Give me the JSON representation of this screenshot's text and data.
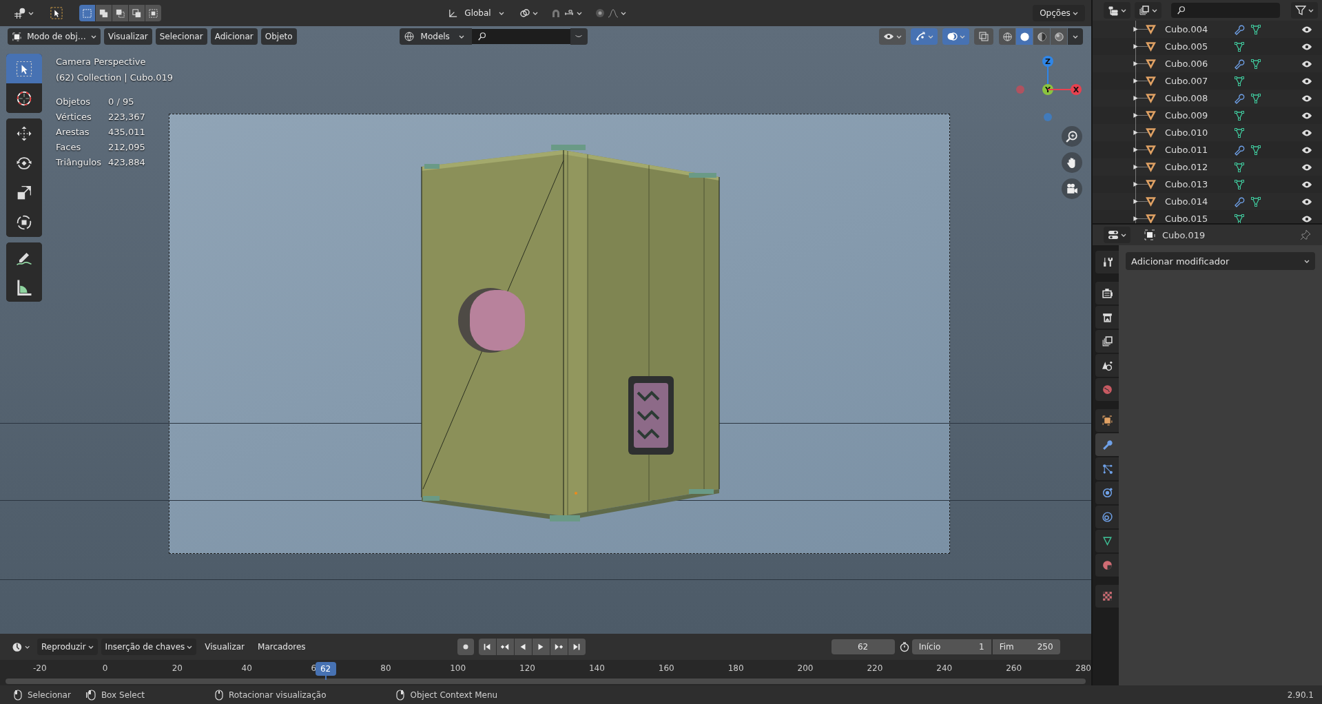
{
  "header": {
    "orientation": "Global",
    "snap_on": false,
    "proportional_on": false,
    "options": "Opções"
  },
  "select_modes": [
    {
      "selected": true
    },
    {
      "selected": false
    },
    {
      "selected": false
    },
    {
      "selected": false
    },
    {
      "selected": false
    }
  ],
  "viewport_header": {
    "mode": "Modo de obj…",
    "menus": [
      "Visualizar",
      "Selecionar",
      "Adicionar",
      "Objeto"
    ],
    "collection": "Models"
  },
  "viewport_toggles": [
    {
      "kind": "visibility",
      "on": false
    },
    {
      "kind": "gizmo",
      "on": true
    },
    {
      "kind": "overlays",
      "on": true
    },
    {
      "kind": "xray",
      "on": false
    }
  ],
  "shading": [
    {
      "kind": "wireframe",
      "selected": false
    },
    {
      "kind": "solid",
      "selected": true
    },
    {
      "kind": "material",
      "selected": false
    },
    {
      "kind": "rendered",
      "selected": false
    }
  ],
  "tools": [
    {
      "kind": "select_box",
      "selected": true
    },
    {
      "kind": "cursor",
      "selected": false
    },
    {
      "kind": "move",
      "selected": false
    },
    {
      "kind": "rotate",
      "selected": false
    },
    {
      "kind": "scale",
      "selected": false
    },
    {
      "kind": "transform",
      "selected": false
    },
    {
      "kind": "annotate",
      "selected": false
    },
    {
      "kind": "measure",
      "selected": false
    }
  ],
  "overlay": {
    "view": "Camera Perspective",
    "context": "(62) Collection | Cubo.019"
  },
  "stats": [
    {
      "label": "Objetos",
      "value": "0 / 95"
    },
    {
      "label": "Vértices",
      "value": "223,367"
    },
    {
      "label": "Arestas",
      "value": "435,011"
    },
    {
      "label": "Faces",
      "value": "212,095"
    },
    {
      "label": "Triângulos",
      "value": "423,884"
    }
  ],
  "gizmo": [
    {
      "label": "Z",
      "color": "#2f86e8"
    },
    {
      "label": "Y",
      "color": "#8bc43f"
    },
    {
      "label": "X",
      "color": "#e8414f"
    }
  ],
  "outliner": {
    "rows": [
      {
        "name": "Cubo.004",
        "modifier": true
      },
      {
        "name": "Cubo.005",
        "modifier": false
      },
      {
        "name": "Cubo.006",
        "modifier": true
      },
      {
        "name": "Cubo.007",
        "modifier": false
      },
      {
        "name": "Cubo.008",
        "modifier": true
      },
      {
        "name": "Cubo.009",
        "modifier": false
      },
      {
        "name": "Cubo.010",
        "modifier": false
      },
      {
        "name": "Cubo.011",
        "modifier": true
      },
      {
        "name": "Cubo.012",
        "modifier": false
      },
      {
        "name": "Cubo.013",
        "modifier": false
      },
      {
        "name": "Cubo.014",
        "modifier": true
      },
      {
        "name": "Cubo.015",
        "modifier": false
      }
    ]
  },
  "properties": {
    "object": "Cubo.019",
    "add_modifier": "Adicionar modificador",
    "tabs": [
      {
        "kind": "tool",
        "selected": false
      },
      {
        "kind": "render",
        "selected": false
      },
      {
        "kind": "output",
        "selected": false
      },
      {
        "kind": "view_layer",
        "selected": false
      },
      {
        "kind": "scene",
        "selected": false
      },
      {
        "kind": "world",
        "selected": false
      },
      {
        "kind": "object",
        "selected": false
      },
      {
        "kind": "modifiers",
        "selected": true
      },
      {
        "kind": "particles",
        "selected": false
      },
      {
        "kind": "physics",
        "selected": false
      },
      {
        "kind": "constraints",
        "selected": false
      },
      {
        "kind": "data",
        "selected": false
      },
      {
        "kind": "material",
        "selected": false
      },
      {
        "kind": "texture",
        "selected": false
      }
    ]
  },
  "timeline": {
    "menus": [
      "Reproduzir",
      "Inserção de chaves",
      "Visualizar",
      "Marcadores"
    ],
    "current_frame": "62",
    "start_label": "Início",
    "start": "1",
    "end_label": "Fim",
    "end": "250",
    "ruler": [
      "-20",
      "0",
      "20",
      "40",
      "6",
      "80",
      "100",
      "120",
      "140",
      "160",
      "180",
      "200",
      "220",
      "240",
      "260",
      "280"
    ],
    "playhead": "62"
  },
  "status_bar": {
    "hints": [
      {
        "kind": "left",
        "text": "Selecionar"
      },
      {
        "kind": "left_drag",
        "text": "Box Select"
      },
      {
        "kind": "middle",
        "text": "Rotacionar visualização"
      },
      {
        "kind": "right",
        "text": "Object Context Menu"
      }
    ],
    "version": "2.90.1"
  }
}
